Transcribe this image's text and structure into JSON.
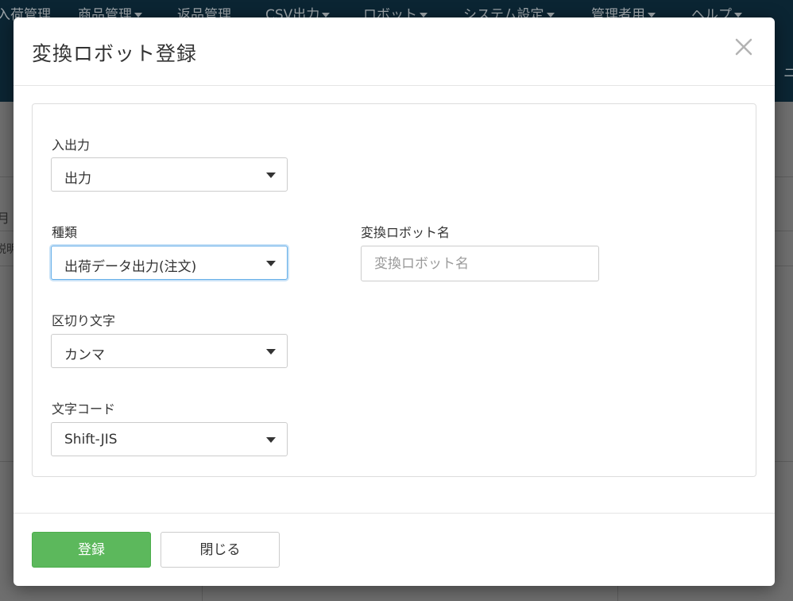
{
  "background": {
    "nav_items": [
      {
        "label": "入荷管理",
        "caret": false
      },
      {
        "label": "商品管理",
        "caret": true
      },
      {
        "label": "返品管理",
        "caret": false
      },
      {
        "label": "CSV出力",
        "caret": true
      },
      {
        "label": "ロボット",
        "caret": true
      },
      {
        "label": "システム設定",
        "caret": true
      },
      {
        "label": "管理者用",
        "caret": true
      },
      {
        "label": "ヘルプ",
        "caret": true
      }
    ],
    "nav_edge_text": "ニ",
    "side_texts": [
      "月",
      "説明"
    ]
  },
  "modal": {
    "title": "変換ロボット登録",
    "close_symbol": "×",
    "fields": {
      "io": {
        "label": "入出力",
        "value": "出力"
      },
      "type": {
        "label": "種類",
        "value": "出荷データ出力(注文)"
      },
      "robot_name": {
        "label": "変換ロボット名",
        "value": "",
        "placeholder": "変換ロボット名"
      },
      "delimiter": {
        "label": "区切り文字",
        "value": "カンマ"
      },
      "encoding": {
        "label": "文字コード",
        "value": "Shift-JIS"
      }
    },
    "buttons": {
      "submit": "登録",
      "close": "閉じる"
    }
  },
  "colors": {
    "primary": "#5cb85c",
    "focus": "#66afe9",
    "navbar": "#0b2533"
  }
}
